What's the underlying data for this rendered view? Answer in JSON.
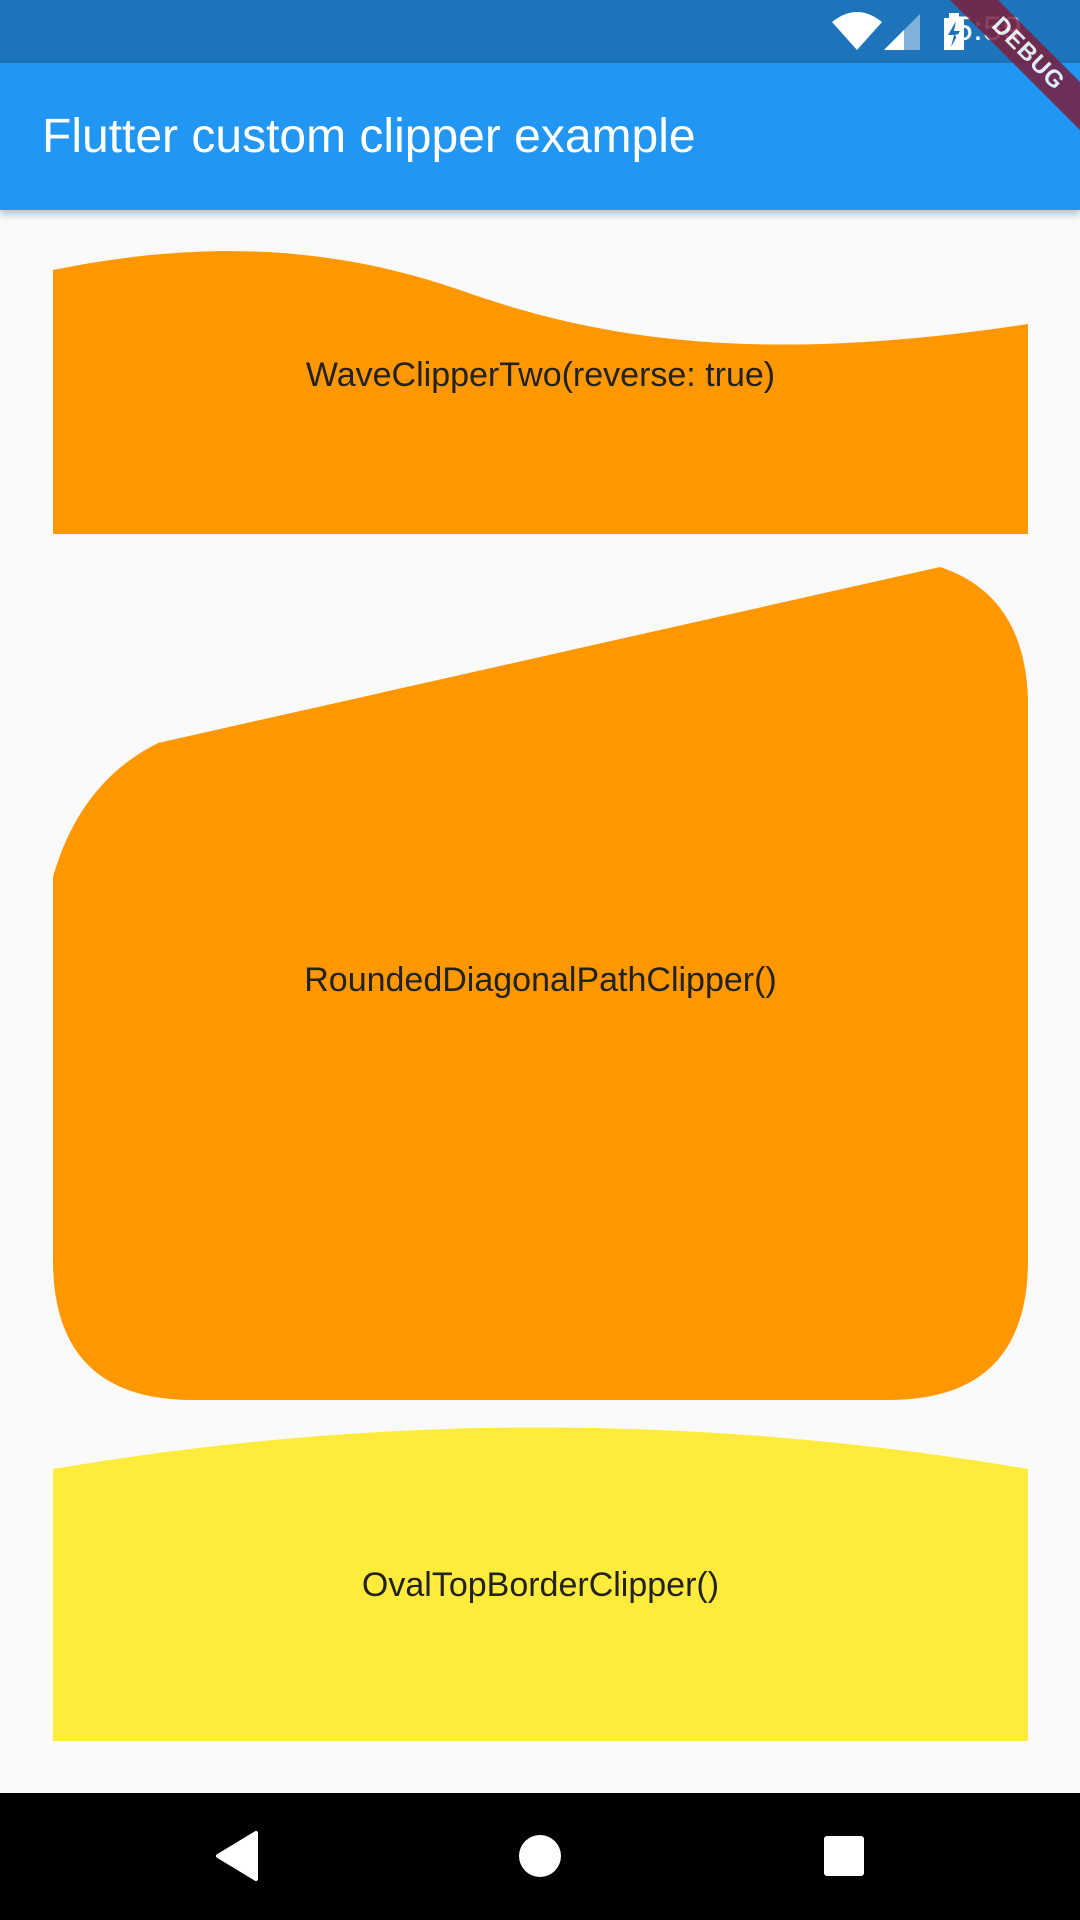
{
  "status_bar": {
    "time": "5:59",
    "icons": [
      "wifi-icon",
      "cell-signal-icon",
      "battery-charging-icon"
    ]
  },
  "app_bar": {
    "title": "Flutter custom clipper example"
  },
  "debug_banner": {
    "label": "DEBUG"
  },
  "clippers": [
    {
      "label": "WaveClipperTwo(reverse: true)",
      "color": "#FF9800"
    },
    {
      "label": "RoundedDiagonalPathClipper()",
      "color": "#FF9800"
    },
    {
      "label": "OvalTopBorderClipper()",
      "color": "#FFEB3B"
    }
  ],
  "nav_bar": {
    "buttons": [
      "back-icon",
      "home-icon",
      "recents-icon"
    ]
  },
  "colors": {
    "status_bar": "#1E74BA",
    "app_bar": "#2196F3",
    "background": "#FAFAFA",
    "orange": "#FF9800",
    "yellow": "#FFEB3B"
  }
}
